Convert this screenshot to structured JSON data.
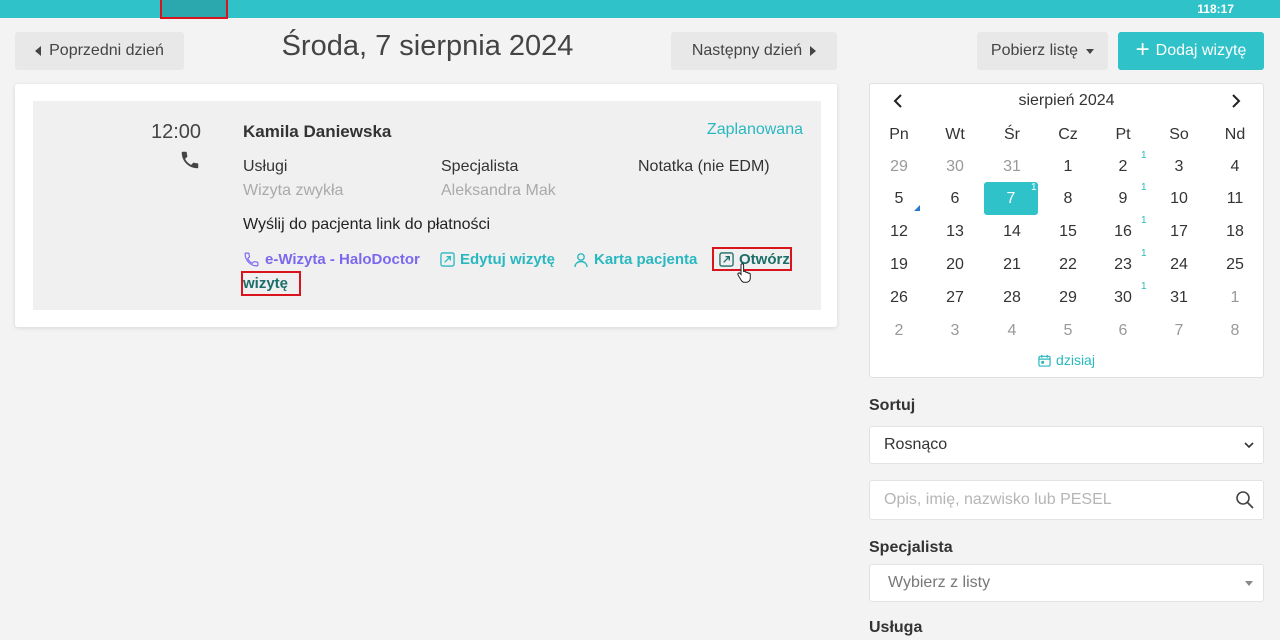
{
  "topbar": {
    "clock": "118:17"
  },
  "header": {
    "prev_day": "Poprzedni dzień",
    "title": "Środa, 7 sierpnia 2024",
    "next_day": "Następny dzień",
    "download_list": "Pobierz listę",
    "add_visit": "Dodaj wizytę"
  },
  "visit": {
    "time": "12:00",
    "patient": "Kamila Daniewska",
    "status": "Zaplanowana",
    "services_label": "Usługi",
    "services_value": "Wizyta zwykła",
    "specialist_label": "Specjalista",
    "specialist_value": "Aleksandra Mak",
    "note_label": "Notatka (nie EDM)",
    "payment_link": "Wyślij do pacjenta link do płatności",
    "actions": {
      "ewizyta": "e-Wizyta - HaloDoctor",
      "edit": "Edytuj wizytę",
      "patient_card": "Karta pacjenta",
      "open_line1": "Otwórz",
      "open_line2": "wizytę"
    }
  },
  "calendar": {
    "month": "sierpień 2024",
    "weekdays": [
      "Pn",
      "Wt",
      "Śr",
      "Cz",
      "Pt",
      "So",
      "Nd"
    ],
    "weeks": [
      [
        "29",
        "30",
        "31",
        "1",
        "2",
        "3",
        "4"
      ],
      [
        "5",
        "6",
        "7",
        "8",
        "9",
        "10",
        "11"
      ],
      [
        "12",
        "13",
        "14",
        "15",
        "16",
        "17",
        "18"
      ],
      [
        "19",
        "20",
        "21",
        "22",
        "23",
        "24",
        "25"
      ],
      [
        "26",
        "27",
        "28",
        "29",
        "30",
        "31",
        "1"
      ],
      [
        "2",
        "3",
        "4",
        "5",
        "6",
        "7",
        "8"
      ]
    ],
    "badge_count": "1",
    "today": "dzisiaj",
    "accent_color": "#2fc2c8"
  },
  "filters": {
    "sort_label": "Sortuj",
    "sort_value": "Rosnąco",
    "search_placeholder": "Opis, imię, nazwisko lub PESEL",
    "specialist_label": "Specjalista",
    "specialist_placeholder": "Wybierz z listy",
    "service_label": "Usługa"
  }
}
